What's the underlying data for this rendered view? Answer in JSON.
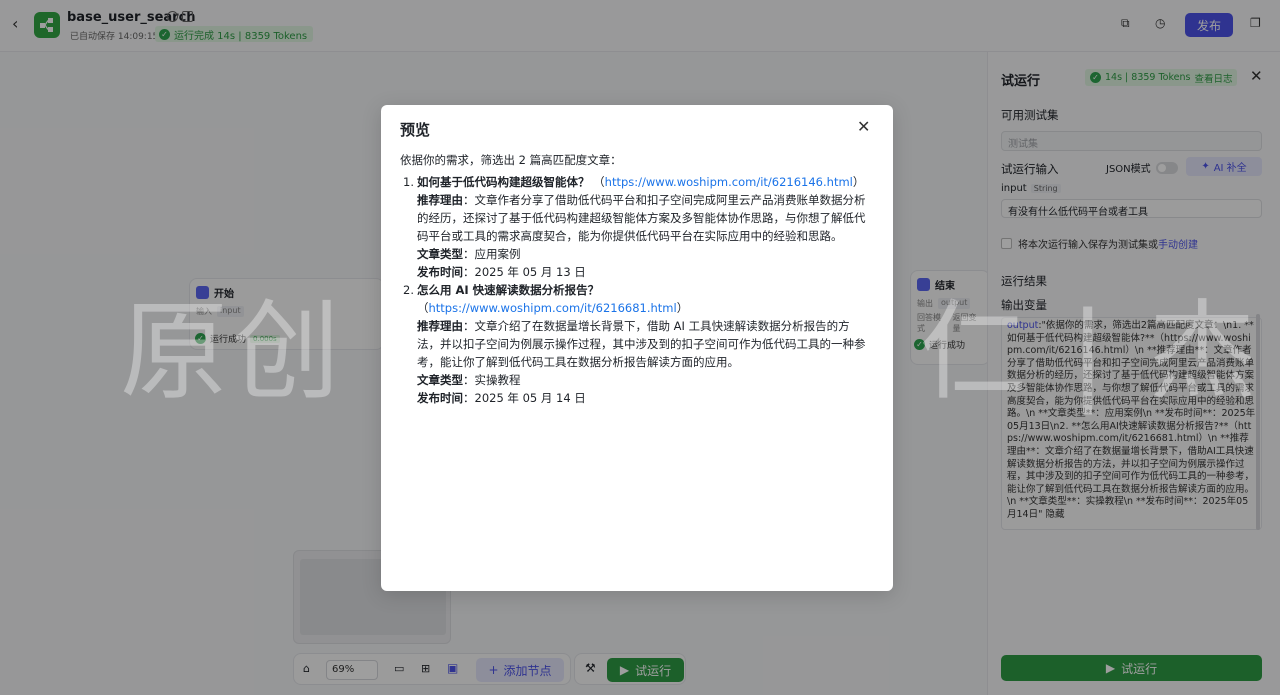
{
  "header": {
    "app_title": "base_user_search",
    "autosave": "已自动保存 14:09:15",
    "run_status": "运行完成 14s | 8359 Tokens",
    "publish": "发布"
  },
  "canvas": {
    "start_node": {
      "title": "开始",
      "input_label": "输入",
      "input_var": "input",
      "run": "运行成功",
      "pct": "0.000s"
    },
    "end_node": {
      "title": "结束",
      "output_label": "输出",
      "output_var": "output",
      "mode_label": "回答模式",
      "mode_value": "返回变量",
      "run": "运行成功"
    },
    "zoom": "69%",
    "add_node": "添加节点",
    "run": "试运行"
  },
  "panel": {
    "title": "试运行",
    "stat": "14s | 8359 Tokens",
    "view_log": "查看日志",
    "testset_label": "可用测试集",
    "testset_placeholder": "测试集",
    "run_input_label": "试运行输入",
    "json_mode": "JSON模式",
    "ai_fill": "AI 补全",
    "input_name": "input",
    "input_type": "String",
    "input_value": "有没有什么低代码平台或者工具",
    "save_text": "将本次运行输入保存为测试集或",
    "manual_create": "手动创建",
    "result_label": "运行结果",
    "output_var_label": "输出变量",
    "output_key": "output",
    "output_value": ":\"依据你的需求，筛选出2篇高匹配度文章：\\n1. **如何基于低代码构建超级智能体?**（https://www.woshipm.com/it/6216146.html）\\n **推荐理由**：文章作者分享了借助低代码平台和扣子空间完成阿里云产品消费账单数据分析的经历，还探讨了基于低代码构建超级智能体方案及多智能体协作思路，与你想了解低代码平台或工具的需求高度契合，能为你提供低代码平台在实际应用中的经验和思路。\\n **文章类型**：应用案例\\n **发布时间**：2025年05月13日\\n2. **怎么用AI快速解读数据分析报告?**（https://www.woshipm.com/it/6216681.html）\\n **推荐理由**：文章介绍了在数据量增长背景下，借助AI工具快速解读数据分析报告的方法，并以扣子空间为例展示操作过程，其中涉及到的扣子空间可作为低代码工具的一种参考，能让你了解到低代码工具在数据分析报告解读方面的应用。\\n **文章类型**：实操教程\\n **发布时间**：2025年05月14日\" 隐藏",
    "run_button": "试运行"
  },
  "watermark": "原创 | 已 | 简 | 仁 | 杰",
  "modal": {
    "title": "预览",
    "intro": "依据你的需求，筛选出 2 篇高匹配度文章：",
    "articles": [
      {
        "num": "1.",
        "title": "如何基于低代码构建超级智能体？",
        "url": "https://www.woshipm.com/it/6216146.html",
        "reason_label": "推荐理由",
        "reason": "：文章作者分享了借助低代码平台和扣子空间完成阿里云产品消费账单数据分析的经历，还探讨了基于低代码构建超级智能体方案及多智能体协作思路，与你想了解低代码平台或工具的需求高度契合，能为你提供低代码平台在实际应用中的经验和思路。",
        "type_label": "文章类型",
        "type": "：应用案例",
        "date_label": "发布时间",
        "date": "：2025 年 05 月 13 日"
      },
      {
        "num": "2.",
        "title": "怎么用 AI 快速解读数据分析报告？",
        "url": "https://www.woshipm.com/it/6216681.html",
        "reason_label": "推荐理由",
        "reason": "：文章介绍了在数据量增长背景下，借助 AI 工具快速解读数据分析报告的方法，并以扣子空间为例展示操作过程，其中涉及到的扣子空间可作为低代码工具的一种参考，能让你了解到低代码工具在数据分析报告解读方面的应用。",
        "type_label": "文章类型",
        "type": "：实操教程",
        "date_label": "发布时间",
        "date": "：2025 年 05 月 14 日"
      }
    ]
  }
}
